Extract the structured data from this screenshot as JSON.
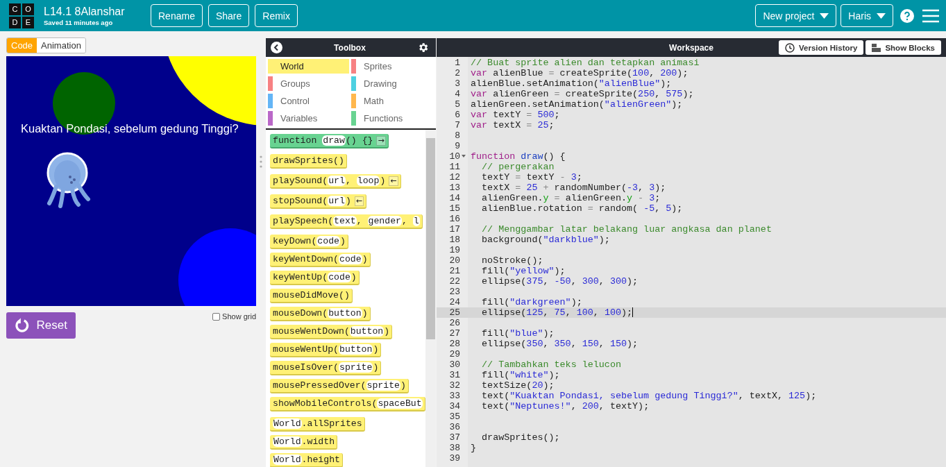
{
  "header": {
    "logo_letters": [
      "C",
      "O",
      "D",
      "E"
    ],
    "project_title": "L14.1 8Alanshar",
    "saved_status": "Saved 11 minutes ago",
    "actions": [
      "Rename",
      "Share",
      "Remix"
    ],
    "new_project": "New project",
    "user": "Haris"
  },
  "left_pane": {
    "tabs": [
      {
        "label": "Code",
        "selected": true
      },
      {
        "label": "Animation",
        "selected": false
      }
    ],
    "preview_text": "Kuaktan Pondasi, sebelum gedung Tinggi?",
    "reset": "Reset",
    "show_grid": {
      "label": "Show grid",
      "checked": false
    }
  },
  "toolbox": {
    "title": "Toolbox",
    "categories": [
      {
        "name": "World",
        "color": "#fff176",
        "selected": true
      },
      {
        "name": "Sprites",
        "color": "#f78183",
        "selected": false
      },
      {
        "name": "Groups",
        "color": "#f78183",
        "selected": false
      },
      {
        "name": "Drawing",
        "color": "#4dd0e1",
        "selected": false
      },
      {
        "name": "Control",
        "color": "#64b5f6",
        "selected": false
      },
      {
        "name": "Math",
        "color": "#ffb74d",
        "selected": false
      },
      {
        "name": "Variables",
        "color": "#ba68c8",
        "selected": false
      },
      {
        "name": "Functions",
        "color": "#68d391",
        "selected": false
      }
    ],
    "blocks": [
      {
        "kind": "event",
        "arrow": "→",
        "parts": [
          {
            "kind": "text",
            "text": "function "
          },
          {
            "kind": "param",
            "text": "draw"
          },
          {
            "kind": "text",
            "text": "() {}"
          }
        ]
      },
      {
        "kind": "command",
        "parts": [
          {
            "kind": "text",
            "text": "drawSprites()"
          }
        ]
      },
      {
        "kind": "command",
        "arrow": "←",
        "parts": [
          {
            "kind": "text",
            "text": "playSound("
          },
          {
            "kind": "param",
            "text": "url"
          },
          {
            "kind": "text",
            "text": ", "
          },
          {
            "kind": "param",
            "text": "loop"
          },
          {
            "kind": "text",
            "text": ")"
          }
        ]
      },
      {
        "kind": "command",
        "arrow": "←",
        "parts": [
          {
            "kind": "text",
            "text": "stopSound("
          },
          {
            "kind": "param",
            "text": "url"
          },
          {
            "kind": "text",
            "text": ")"
          }
        ]
      },
      {
        "kind": "command",
        "parts": [
          {
            "kind": "text",
            "text": "playSpeech("
          },
          {
            "kind": "param",
            "text": "text"
          },
          {
            "kind": "text",
            "text": ", "
          },
          {
            "kind": "param",
            "text": "gender"
          },
          {
            "kind": "text",
            "text": ", "
          },
          {
            "kind": "param",
            "text": "l"
          }
        ]
      },
      {
        "kind": "value",
        "parts": [
          {
            "kind": "text",
            "text": "keyDown("
          },
          {
            "kind": "param",
            "text": "code"
          },
          {
            "kind": "text",
            "text": ")"
          }
        ]
      },
      {
        "kind": "value",
        "parts": [
          {
            "kind": "text",
            "text": "keyWentDown("
          },
          {
            "kind": "param",
            "text": "code"
          },
          {
            "kind": "text",
            "text": ")"
          }
        ]
      },
      {
        "kind": "value",
        "parts": [
          {
            "kind": "text",
            "text": "keyWentUp("
          },
          {
            "kind": "param",
            "text": "code"
          },
          {
            "kind": "text",
            "text": ")"
          }
        ]
      },
      {
        "kind": "value",
        "parts": [
          {
            "kind": "text",
            "text": "mouseDidMove()"
          }
        ]
      },
      {
        "kind": "value",
        "parts": [
          {
            "kind": "text",
            "text": "mouseDown("
          },
          {
            "kind": "param",
            "text": "button"
          },
          {
            "kind": "text",
            "text": ")"
          }
        ]
      },
      {
        "kind": "value",
        "parts": [
          {
            "kind": "text",
            "text": "mouseWentDown("
          },
          {
            "kind": "param",
            "text": "button"
          },
          {
            "kind": "text",
            "text": ")"
          }
        ]
      },
      {
        "kind": "value",
        "parts": [
          {
            "kind": "text",
            "text": "mouseWentUp("
          },
          {
            "kind": "param",
            "text": "button"
          },
          {
            "kind": "text",
            "text": ")"
          }
        ]
      },
      {
        "kind": "value",
        "parts": [
          {
            "kind": "text",
            "text": "mouseIsOver("
          },
          {
            "kind": "param",
            "text": "sprite"
          },
          {
            "kind": "text",
            "text": ")"
          }
        ]
      },
      {
        "kind": "value",
        "parts": [
          {
            "kind": "text",
            "text": "mousePressedOver("
          },
          {
            "kind": "param",
            "text": "sprite"
          },
          {
            "kind": "text",
            "text": ")"
          }
        ]
      },
      {
        "kind": "command",
        "parts": [
          {
            "kind": "text",
            "text": "showMobileControls("
          },
          {
            "kind": "param",
            "text": "spaceBut"
          }
        ]
      },
      {
        "kind": "value",
        "parts": [
          {
            "kind": "param",
            "text": "World"
          },
          {
            "kind": "text",
            "text": ".allSprites"
          }
        ]
      },
      {
        "kind": "value",
        "parts": [
          {
            "kind": "param",
            "text": "World"
          },
          {
            "kind": "text",
            "text": ".width"
          }
        ]
      },
      {
        "kind": "value",
        "parts": [
          {
            "kind": "param",
            "text": "World"
          },
          {
            "kind": "text",
            "text": ".height"
          }
        ]
      }
    ]
  },
  "workspace": {
    "title": "Workspace",
    "version_history": "Version History",
    "show_blocks": "Show Blocks",
    "lines": [
      {
        "number": "1",
        "current": false,
        "foldable": false,
        "tokens": [
          {
            "kind": "comment",
            "text": "// Buat sprite alien dan tetapkan animasi"
          }
        ]
      },
      {
        "number": "2",
        "current": false,
        "foldable": false,
        "tokens": [
          {
            "kind": "keyword",
            "text": "var"
          },
          {
            "kind": "plain",
            "text": " alienBlue "
          },
          {
            "kind": "operator",
            "text": "="
          },
          {
            "kind": "plain",
            "text": " createSprite("
          },
          {
            "kind": "number",
            "text": "100"
          },
          {
            "kind": "plain",
            "text": ", "
          },
          {
            "kind": "number",
            "text": "200"
          },
          {
            "kind": "plain",
            "text": ");"
          }
        ]
      },
      {
        "number": "3",
        "current": false,
        "foldable": false,
        "tokens": [
          {
            "kind": "plain",
            "text": "alienBlue.setAnimation("
          },
          {
            "kind": "string",
            "text": "\"alienBlue\""
          },
          {
            "kind": "plain",
            "text": ");"
          }
        ]
      },
      {
        "number": "4",
        "current": false,
        "foldable": false,
        "tokens": [
          {
            "kind": "keyword",
            "text": "var"
          },
          {
            "kind": "plain",
            "text": " alienGreen "
          },
          {
            "kind": "operator",
            "text": "="
          },
          {
            "kind": "plain",
            "text": " createSprite("
          },
          {
            "kind": "number",
            "text": "250"
          },
          {
            "kind": "plain",
            "text": ", "
          },
          {
            "kind": "number",
            "text": "575"
          },
          {
            "kind": "plain",
            "text": ");"
          }
        ]
      },
      {
        "number": "5",
        "current": false,
        "foldable": false,
        "tokens": [
          {
            "kind": "plain",
            "text": "alienGreen.setAnimation("
          },
          {
            "kind": "string",
            "text": "\"alienGreen\""
          },
          {
            "kind": "plain",
            "text": ");"
          }
        ]
      },
      {
        "number": "6",
        "current": false,
        "foldable": false,
        "tokens": [
          {
            "kind": "keyword",
            "text": "var"
          },
          {
            "kind": "plain",
            "text": " textY "
          },
          {
            "kind": "operator",
            "text": "= "
          },
          {
            "kind": "number",
            "text": "500"
          },
          {
            "kind": "plain",
            "text": ";"
          }
        ]
      },
      {
        "number": "7",
        "current": false,
        "foldable": false,
        "tokens": [
          {
            "kind": "keyword",
            "text": "var"
          },
          {
            "kind": "plain",
            "text": " textX "
          },
          {
            "kind": "operator",
            "text": "= "
          },
          {
            "kind": "number",
            "text": "25"
          },
          {
            "kind": "plain",
            "text": ";"
          }
        ]
      },
      {
        "number": "8",
        "current": false,
        "foldable": false
      },
      {
        "number": "9",
        "current": false,
        "foldable": false
      },
      {
        "number": "10",
        "current": false,
        "foldable": true,
        "tokens": [
          {
            "kind": "keyword",
            "text": "function "
          },
          {
            "kind": "def",
            "text": "draw"
          },
          {
            "kind": "plain",
            "text": "() {"
          }
        ]
      },
      {
        "number": "11",
        "current": false,
        "foldable": false,
        "tokens": [
          {
            "kind": "comment",
            "text": "  // pergerakan"
          }
        ]
      },
      {
        "number": "12",
        "current": false,
        "foldable": false,
        "tokens": [
          {
            "kind": "plain",
            "text": "  textY "
          },
          {
            "kind": "operator",
            "text": "="
          },
          {
            "kind": "plain",
            "text": " textY "
          },
          {
            "kind": "operator",
            "text": "- "
          },
          {
            "kind": "number",
            "text": "3"
          },
          {
            "kind": "plain",
            "text": ";"
          }
        ]
      },
      {
        "number": "13",
        "current": false,
        "foldable": false,
        "tokens": [
          {
            "kind": "plain",
            "text": "  textX "
          },
          {
            "kind": "operator",
            "text": "= "
          },
          {
            "kind": "number",
            "text": "25"
          },
          {
            "kind": "operator",
            "text": " + "
          },
          {
            "kind": "plain",
            "text": "randomNumber("
          },
          {
            "kind": "number",
            "text": "-3"
          },
          {
            "kind": "plain",
            "text": ", "
          },
          {
            "kind": "number",
            "text": "3"
          },
          {
            "kind": "plain",
            "text": ");"
          }
        ]
      },
      {
        "number": "14",
        "current": false,
        "foldable": false,
        "tokens": [
          {
            "kind": "plain",
            "text": "  alienGreen."
          },
          {
            "kind": "property",
            "text": "y"
          },
          {
            "kind": "operator",
            "text": " = "
          },
          {
            "kind": "plain",
            "text": "alienGreen."
          },
          {
            "kind": "property",
            "text": "y"
          },
          {
            "kind": "operator",
            "text": " - "
          },
          {
            "kind": "number",
            "text": "3"
          },
          {
            "kind": "plain",
            "text": ";"
          }
        ]
      },
      {
        "number": "15",
        "current": false,
        "foldable": false,
        "tokens": [
          {
            "kind": "plain",
            "text": "  alienBlue.rotation "
          },
          {
            "kind": "operator",
            "text": "="
          },
          {
            "kind": "plain",
            "text": " random( "
          },
          {
            "kind": "number",
            "text": "-5"
          },
          {
            "kind": "plain",
            "text": ", "
          },
          {
            "kind": "number",
            "text": "5"
          },
          {
            "kind": "plain",
            "text": ");"
          }
        ]
      },
      {
        "number": "16",
        "current": false,
        "foldable": false
      },
      {
        "number": "17",
        "current": false,
        "foldable": false,
        "tokens": [
          {
            "kind": "comment",
            "text": "  // Menggambar latar belakang luar angkasa dan planet"
          }
        ]
      },
      {
        "number": "18",
        "current": false,
        "foldable": false,
        "tokens": [
          {
            "kind": "plain",
            "text": "  background("
          },
          {
            "kind": "string",
            "text": "\"darkblue\""
          },
          {
            "kind": "plain",
            "text": ");"
          }
        ]
      },
      {
        "number": "19",
        "current": false,
        "foldable": false
      },
      {
        "number": "20",
        "current": false,
        "foldable": false,
        "tokens": [
          {
            "kind": "plain",
            "text": "  noStroke();"
          }
        ]
      },
      {
        "number": "21",
        "current": false,
        "foldable": false,
        "tokens": [
          {
            "kind": "plain",
            "text": "  fill("
          },
          {
            "kind": "string",
            "text": "\"yellow\""
          },
          {
            "kind": "plain",
            "text": ");"
          }
        ]
      },
      {
        "number": "22",
        "current": false,
        "foldable": false,
        "tokens": [
          {
            "kind": "plain",
            "text": "  ellipse("
          },
          {
            "kind": "number",
            "text": "375"
          },
          {
            "kind": "plain",
            "text": ", "
          },
          {
            "kind": "number",
            "text": "-50"
          },
          {
            "kind": "plain",
            "text": ", "
          },
          {
            "kind": "number",
            "text": "300"
          },
          {
            "kind": "plain",
            "text": ", "
          },
          {
            "kind": "number",
            "text": "300"
          },
          {
            "kind": "plain",
            "text": ");"
          }
        ]
      },
      {
        "number": "23",
        "current": false,
        "foldable": false
      },
      {
        "number": "24",
        "current": false,
        "foldable": false,
        "tokens": [
          {
            "kind": "plain",
            "text": "  fill("
          },
          {
            "kind": "string",
            "text": "\"darkgreen\""
          },
          {
            "kind": "plain",
            "text": ");"
          }
        ]
      },
      {
        "number": "25",
        "current": true,
        "foldable": false,
        "tokens": [
          {
            "kind": "plain",
            "text": "  ellipse("
          },
          {
            "kind": "number",
            "text": "125"
          },
          {
            "kind": "plain",
            "text": ", "
          },
          {
            "kind": "number",
            "text": "75"
          },
          {
            "kind": "plain",
            "text": ", "
          },
          {
            "kind": "number",
            "text": "100"
          },
          {
            "kind": "plain",
            "text": ", "
          },
          {
            "kind": "number",
            "text": "100"
          },
          {
            "kind": "plain",
            "text": ");"
          }
        ]
      },
      {
        "number": "26",
        "current": false,
        "foldable": false
      },
      {
        "number": "27",
        "current": false,
        "foldable": false,
        "tokens": [
          {
            "kind": "plain",
            "text": "  fill("
          },
          {
            "kind": "string",
            "text": "\"blue\""
          },
          {
            "kind": "plain",
            "text": ");"
          }
        ]
      },
      {
        "number": "28",
        "current": false,
        "foldable": false,
        "tokens": [
          {
            "kind": "plain",
            "text": "  ellipse("
          },
          {
            "kind": "number",
            "text": "350"
          },
          {
            "kind": "plain",
            "text": ", "
          },
          {
            "kind": "number",
            "text": "350"
          },
          {
            "kind": "plain",
            "text": ", "
          },
          {
            "kind": "number",
            "text": "150"
          },
          {
            "kind": "plain",
            "text": ", "
          },
          {
            "kind": "number",
            "text": "150"
          },
          {
            "kind": "plain",
            "text": ");"
          }
        ]
      },
      {
        "number": "29",
        "current": false,
        "foldable": false
      },
      {
        "number": "30",
        "current": false,
        "foldable": false,
        "tokens": [
          {
            "kind": "comment",
            "text": "  // Tambahkan teks lelucon"
          }
        ]
      },
      {
        "number": "31",
        "current": false,
        "foldable": false,
        "tokens": [
          {
            "kind": "plain",
            "text": "  fill("
          },
          {
            "kind": "string",
            "text": "\"white\""
          },
          {
            "kind": "plain",
            "text": ");"
          }
        ]
      },
      {
        "number": "32",
        "current": false,
        "foldable": false,
        "tokens": [
          {
            "kind": "plain",
            "text": "  textSize("
          },
          {
            "kind": "number",
            "text": "20"
          },
          {
            "kind": "plain",
            "text": ");"
          }
        ]
      },
      {
        "number": "33",
        "current": false,
        "foldable": false,
        "tokens": [
          {
            "kind": "plain",
            "text": "  text("
          },
          {
            "kind": "string",
            "text": "\"Kuaktan Pondasi, sebelum gedung Tinggi?\""
          },
          {
            "kind": "plain",
            "text": ", textX, "
          },
          {
            "kind": "number",
            "text": "125"
          },
          {
            "kind": "plain",
            "text": ");"
          }
        ]
      },
      {
        "number": "34",
        "current": false,
        "foldable": false,
        "tokens": [
          {
            "kind": "plain",
            "text": "  text("
          },
          {
            "kind": "string",
            "text": "\"Neptunes!\""
          },
          {
            "kind": "plain",
            "text": ", "
          },
          {
            "kind": "number",
            "text": "200"
          },
          {
            "kind": "plain",
            "text": ", textY);"
          }
        ]
      },
      {
        "number": "35",
        "current": false,
        "foldable": false
      },
      {
        "number": "36",
        "current": false,
        "foldable": false
      },
      {
        "number": "37",
        "current": false,
        "foldable": false,
        "tokens": [
          {
            "kind": "plain",
            "text": "  drawSprites();"
          }
        ]
      },
      {
        "number": "38",
        "current": false,
        "foldable": false,
        "tokens": [
          {
            "kind": "plain",
            "text": "}"
          }
        ]
      },
      {
        "number": "39",
        "current": false,
        "foldable": false
      }
    ]
  }
}
